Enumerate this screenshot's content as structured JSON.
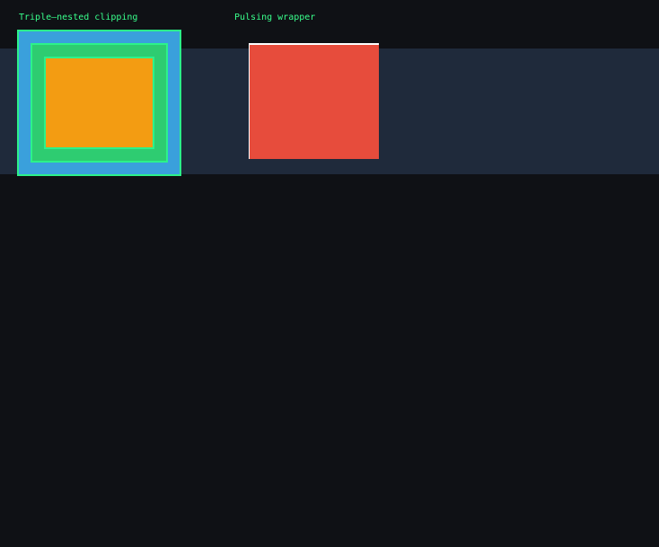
{
  "demos": {
    "nested": {
      "label": "Triple–nested clipping",
      "colors": {
        "outer": "#3aa0dc",
        "middle": "#2ecc71",
        "inner": "#f39c12",
        "outline": "#2cf28a"
      }
    },
    "pulse": {
      "label": "Pulsing wrapper",
      "colors": {
        "fill": "#e74c3c",
        "edge": "#ffffff"
      }
    }
  },
  "theme": {
    "background": "#0f1115",
    "band": "#1f2a3b",
    "label_color": "#39ff8c"
  }
}
